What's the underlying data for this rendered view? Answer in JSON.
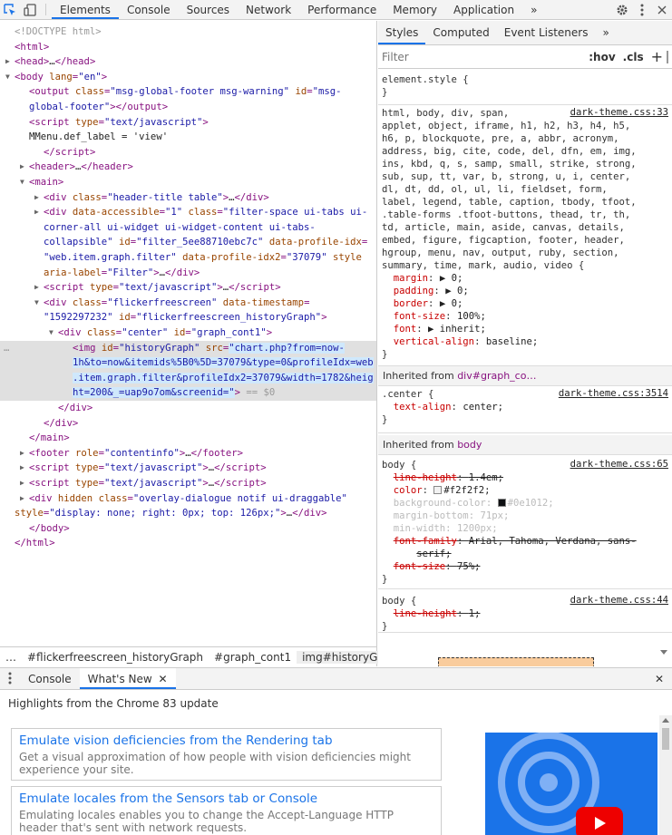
{
  "toolbar": {
    "tabs": [
      "Elements",
      "Console",
      "Sources",
      "Network",
      "Performance",
      "Memory",
      "Application"
    ],
    "overflow": "»"
  },
  "dom_lines": [
    {
      "indent": 0,
      "arrow": "",
      "html": "<span class='cmt'>&lt;!DOCTYPE html&gt;</span>"
    },
    {
      "indent": 0,
      "arrow": "",
      "html": "<span class='tag'>&lt;html&gt;</span>"
    },
    {
      "indent": 0,
      "arrow": "▶",
      "html": "<span class='tag'>&lt;head&gt;</span><span class='txt'>…</span><span class='tag'>&lt;/head&gt;</span>"
    },
    {
      "indent": 0,
      "arrow": "▼",
      "html": "<span class='tag'>&lt;body</span> <span class='attr'>lang</span><span class='tag'>=</span><span class='val'>\"en\"</span><span class='tag'>&gt;</span>"
    },
    {
      "indent": 2,
      "arrow": "",
      "html": "<span class='tag'>&lt;output</span> <span class='attr'>class</span><span class='tag'>=</span><span class='val'>\"msg-global-footer msg-warning\"</span> <span class='attr'>id</span><span class='tag'>=</span><span class='val'>\"msg-</span>"
    },
    {
      "indent": 2,
      "arrow": "",
      "html": "<span class='val'>global-footer\"</span><span class='tag'>&gt;&lt;/output&gt;</span>"
    },
    {
      "indent": 2,
      "arrow": "",
      "html": "<span class='tag'>&lt;script</span> <span class='attr'>type</span><span class='tag'>=</span><span class='val'>\"text/javascript\"</span><span class='tag'>&gt;</span>"
    },
    {
      "indent": 2,
      "arrow": "",
      "html": "<span class='txt'>MMenu.def_label = 'view'</span>"
    },
    {
      "indent": 4,
      "arrow": "",
      "html": "<span class='tag'>&lt;/script&gt;</span>"
    },
    {
      "indent": 2,
      "arrow": "▶",
      "html": "<span class='tag'>&lt;header&gt;</span><span class='txt'>…</span><span class='tag'>&lt;/header&gt;</span>"
    },
    {
      "indent": 2,
      "arrow": "▼",
      "html": "<span class='tag'>&lt;main&gt;</span>"
    },
    {
      "indent": 4,
      "arrow": "▶",
      "html": "<span class='tag'>&lt;div</span> <span class='attr'>class</span><span class='tag'>=</span><span class='val'>\"header-title table\"</span><span class='tag'>&gt;</span><span class='txt'>…</span><span class='tag'>&lt;/div&gt;</span>"
    },
    {
      "indent": 4,
      "arrow": "▶",
      "html": "<span class='tag'>&lt;div</span> <span class='attr'>data-accessible</span><span class='tag'>=</span><span class='val'>\"1\"</span> <span class='attr'>class</span><span class='tag'>=</span><span class='val'>\"filter-space ui-tabs ui-</span>"
    },
    {
      "indent": 4,
      "arrow": "",
      "html": "<span class='val'>corner-all ui-widget ui-widget-content ui-tabs-</span>"
    },
    {
      "indent": 4,
      "arrow": "",
      "html": "<span class='val'>collapsible\"</span> <span class='attr'>id</span><span class='tag'>=</span><span class='val'>\"filter_5ee88710ebc7c\"</span> <span class='attr'>data-profile-idx</span><span class='tag'>=</span>"
    },
    {
      "indent": 4,
      "arrow": "",
      "html": "<span class='val'>\"web.item.graph.filter\"</span> <span class='attr'>data-profile-idx2</span><span class='tag'>=</span><span class='val'>\"37079\"</span> <span class='attr'>style</span>"
    },
    {
      "indent": 4,
      "arrow": "",
      "html": "<span class='attr'>aria-label</span><span class='tag'>=</span><span class='val'>\"Filter\"</span><span class='tag'>&gt;</span><span class='txt'>…</span><span class='tag'>&lt;/div&gt;</span>"
    },
    {
      "indent": 4,
      "arrow": "▶",
      "html": "<span class='tag'>&lt;script</span> <span class='attr'>type</span><span class='tag'>=</span><span class='val'>\"text/javascript\"</span><span class='tag'>&gt;</span><span class='txt'>…</span><span class='tag'>&lt;/script&gt;</span>"
    },
    {
      "indent": 4,
      "arrow": "▼",
      "html": "<span class='tag'>&lt;div</span> <span class='attr'>class</span><span class='tag'>=</span><span class='val'>\"flickerfreescreen\"</span> <span class='attr'>data-timestamp</span><span class='tag'>=</span>"
    },
    {
      "indent": 4,
      "arrow": "",
      "html": "<span class='val'>\"1592297232\"</span> <span class='attr'>id</span><span class='tag'>=</span><span class='val'>\"flickerfreescreen_historyGraph\"</span><span class='tag'>&gt;</span>"
    },
    {
      "indent": 6,
      "arrow": "▼",
      "html": "<span class='tag'>&lt;div</span> <span class='attr'>class</span><span class='tag'>=</span><span class='val'>\"center\"</span> <span class='attr'>id</span><span class='tag'>=</span><span class='val'>\"graph_cont1\"</span><span class='tag'>&gt;</span>"
    },
    {
      "indent": 8,
      "arrow": "",
      "sel": true,
      "html": "<span class='tag'>&lt;img</span> <span class='attr'>id</span><span class='tag'>=</span><span class='val'>\"historyGraph\"</span> <span class='attr'>src</span><span class='tag'>=</span><span class='val hl'>\"chart.php?from=now-</span>"
    },
    {
      "indent": 8,
      "arrow": "",
      "sel": true,
      "html": "<span class='val hl'>1h&amp;to=now&amp;itemids%5B0%5D=37079&amp;type=0&amp;profileIdx=web</span>"
    },
    {
      "indent": 8,
      "arrow": "",
      "sel": true,
      "html": "<span class='val hl'>.item.graph.filter&amp;profileIdx2=37079&amp;width=1782&amp;heig</span>"
    },
    {
      "indent": 8,
      "arrow": "",
      "sel": true,
      "html": "<span class='val hl'>ht=200&amp;_=uap9o7om&amp;screenid=\"</span><span class='tag'>&gt;</span> <span class='cmt'>== $0</span>"
    },
    {
      "indent": 6,
      "arrow": "",
      "html": "<span class='tag'>&lt;/div&gt;</span>"
    },
    {
      "indent": 4,
      "arrow": "",
      "html": "<span class='tag'>&lt;/div&gt;</span>"
    },
    {
      "indent": 2,
      "arrow": "",
      "html": "<span class='tag'>&lt;/main&gt;</span>"
    },
    {
      "indent": 2,
      "arrow": "▶",
      "html": "<span class='tag'>&lt;footer</span> <span class='attr'>role</span><span class='tag'>=</span><span class='val'>\"contentinfo\"</span><span class='tag'>&gt;</span><span class='txt'>…</span><span class='tag'>&lt;/footer&gt;</span>"
    },
    {
      "indent": 2,
      "arrow": "▶",
      "html": "<span class='tag'>&lt;script</span> <span class='attr'>type</span><span class='tag'>=</span><span class='val'>\"text/javascript\"</span><span class='tag'>&gt;</span><span class='txt'>…</span><span class='tag'>&lt;/script&gt;</span>"
    },
    {
      "indent": 2,
      "arrow": "▶",
      "html": "<span class='tag'>&lt;script</span> <span class='attr'>type</span><span class='tag'>=</span><span class='val'>\"text/javascript\"</span><span class='tag'>&gt;</span><span class='txt'>…</span><span class='tag'>&lt;/script&gt;</span>"
    },
    {
      "indent": 2,
      "arrow": "▶",
      "html": "<span class='tag'>&lt;div</span> <span class='attr'>hidden</span> <span class='attr'>class</span><span class='tag'>=</span><span class='val'>\"overlay-dialogue notif ui-draggable\"</span>"
    },
    {
      "indent": 0,
      "arrow": "",
      "html": "<span class='attr'>style</span><span class='tag'>=</span><span class='val'>\"display: none; right: 0px; top: 126px;\"</span><span class='tag'>&gt;</span><span class='txt'>…</span><span class='tag'>&lt;/div&gt;</span>"
    },
    {
      "indent": 2,
      "arrow": "",
      "html": "<span class='tag'>&lt;/body&gt;</span>"
    },
    {
      "indent": 0,
      "arrow": "",
      "html": "<span class='tag'>&lt;/html&gt;</span>"
    }
  ],
  "breadcrumbs": [
    "…",
    "#flickerfreescreen_historyGraph",
    "#graph_cont1",
    "img#historyGraph"
  ],
  "styles": {
    "tabs": [
      "Styles",
      "Computed",
      "Event Listeners"
    ],
    "filter_placeholder": "Filter",
    "hov": ":hov",
    "cls": ".cls",
    "element_style": "element.style {",
    "rule1_src": "dark-theme.css:33",
    "rule1_selector": [
      "html, body, div, span,",
      "applet, object, iframe, h1, h2, h3, h4, h5,",
      "h6, p, blockquote, pre, a, abbr, acronym,",
      "address, big, cite, code, del, dfn, em, img,",
      "ins, kbd, q, s, samp, small, strike, strong,",
      "sub, sup, tt, var, b, strong, u, i, center,",
      "dl, dt, dd, ol, ul, li, fieldset, form,",
      "label, legend, table, caption, tbody, tfoot,",
      ".table-forms .tfoot-buttons, thead, tr, th,",
      "td, article, main, aside, canvas, details,",
      "embed, figure, figcaption, footer, header,",
      "hgroup, menu, nav, output, ruby, section,",
      "summary, time, mark, audio, video {"
    ],
    "rule1_props": [
      {
        "name": "margin",
        "value": "▶ 0;"
      },
      {
        "name": "padding",
        "value": "▶ 0;"
      },
      {
        "name": "border",
        "value": "▶ 0;"
      },
      {
        "name": "font-size",
        "value": "100%;"
      },
      {
        "name": "font",
        "value": "▶ inherit;"
      },
      {
        "name": "vertical-align",
        "value": "baseline;"
      }
    ],
    "inherited1_label": "Inherited from",
    "inherited1_from": "div#graph_co…",
    "rule2_selector": ".center {",
    "rule2_src": "dark-theme.css:3514",
    "rule2_prop": "text-align",
    "rule2_val": "center;",
    "inherited2_label": "Inherited from",
    "inherited2_from": "body",
    "rule3_selector": "body {",
    "rule3_src": "dark-theme.css:65",
    "rule3_props": [
      {
        "name": "line-height",
        "value": "1.4em;",
        "strike": true
      },
      {
        "name": "color",
        "value": "#f2f2f2;",
        "swatch": "#f2f2f2"
      },
      {
        "name": "background-color",
        "value": "#0e1012;",
        "swatch": "#0e1012",
        "dim": true
      },
      {
        "name": "margin-bottom",
        "value": "71px;",
        "dim": true
      },
      {
        "name": "min-width",
        "value": "1200px;",
        "dim": true
      },
      {
        "name": "font-family",
        "value": "Arial, Tahoma, Verdana, sans-",
        "strike": true
      },
      {
        "name": "",
        "value": "serif;",
        "strike": true,
        "cont": true
      },
      {
        "name": "font-size",
        "value": "75%;",
        "strike": true
      }
    ],
    "rule4_selector": "body {",
    "rule4_src": "dark-theme.css:44",
    "rule4_prop": "line-height",
    "rule4_val": "1;",
    "close": "}"
  },
  "drawer": {
    "tabs": [
      "Console",
      "What's New"
    ],
    "heading": "Highlights from the Chrome 83 update",
    "cards": [
      {
        "title": "Emulate vision deficiencies from the Rendering tab",
        "desc": "Get a visual approximation of how people with vision deficiencies might experience your site."
      },
      {
        "title": "Emulate locales from the Sensors tab or Console",
        "desc": "Emulating locales enables you to change the Accept-Language HTTP header that's sent with network requests."
      }
    ]
  },
  "colors": {
    "accent": "#1a73e8",
    "tag": "#881280",
    "attr": "#994500",
    "value": "#1a1aa6"
  }
}
